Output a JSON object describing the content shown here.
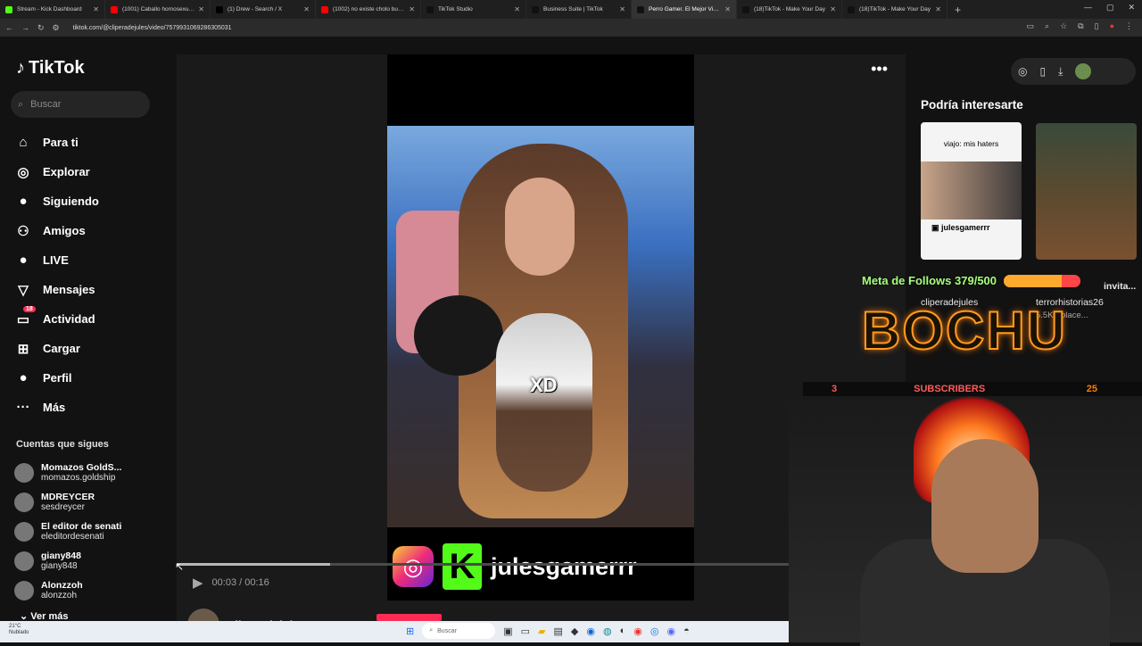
{
  "browser": {
    "tabs": [
      {
        "label": "Stream - Kick Dashboard",
        "color": "#53fc18"
      },
      {
        "label": "(1001) Caballo homosexual de",
        "color": "#ff0000"
      },
      {
        "label": "(1) Drew - Search / X",
        "color": "#000000"
      },
      {
        "label": "(1002) no existe cholo bueno",
        "color": "#ff0000"
      },
      {
        "label": "TikTok Studio",
        "color": "#111111"
      },
      {
        "label": "Business Suite | TikTok",
        "color": "#111111"
      },
      {
        "label": "Perro Gamer. El Mejor Video d",
        "color": "#111111",
        "active": true
      },
      {
        "label": "(18)TikTok - Make Your Day",
        "color": "#111111"
      },
      {
        "label": "(18)TikTok - Make Your Day",
        "color": "#111111"
      }
    ],
    "url": "tiktok.com/@cliperadejules/video/7579931069286305031"
  },
  "sidebar": {
    "logo": "TikTok",
    "search_placeholder": "Buscar",
    "nav": [
      {
        "label": "Para ti",
        "icon": "home-icon",
        "glyph": "⌂"
      },
      {
        "label": "Explorar",
        "icon": "compass-icon",
        "glyph": "◎"
      },
      {
        "label": "Siguiendo",
        "icon": "following-avatar-icon",
        "glyph": "●"
      },
      {
        "label": "Amigos",
        "icon": "friends-icon",
        "glyph": "⚇"
      },
      {
        "label": "LIVE",
        "icon": "live-icon",
        "glyph": "●"
      },
      {
        "label": "Mensajes",
        "icon": "messages-icon",
        "glyph": "▽"
      },
      {
        "label": "Actividad",
        "icon": "activity-icon",
        "glyph": "▭",
        "badge": "18"
      },
      {
        "label": "Cargar",
        "icon": "upload-icon",
        "glyph": "⊞"
      },
      {
        "label": "Perfil",
        "icon": "profile-icon",
        "glyph": "●"
      },
      {
        "label": "Más",
        "icon": "more-icon",
        "glyph": "···"
      }
    ],
    "following_title": "Cuentas que sigues",
    "following": [
      {
        "name": "Momazos GoldS...",
        "handle": "momazos.goldship"
      },
      {
        "name": "MDREYCER",
        "handle": "sesdreycer"
      },
      {
        "name": "El editor de senati",
        "handle": "eleditordesenati"
      },
      {
        "name": "giany848",
        "handle": "giany848"
      },
      {
        "name": "Alonzzoh",
        "handle": "alonzzoh"
      }
    ],
    "see_more": "Ver más"
  },
  "video": {
    "caption_overlay": "XD",
    "social_handle": "julesgamerrr",
    "time": "00:03 / 00:16",
    "progress": 0.25,
    "author": "cliperadejules"
  },
  "right": {
    "title": "Podría interesarte",
    "thumb1_caption": "viajo: mis haters",
    "thumb1_handle": "julesgamerrr",
    "card1_name": "cliperadejules",
    "card2_name": "terrorhistorias26",
    "card2_partial": "invita...",
    "card2_meta": "5.5K · place..."
  },
  "stream_overlay": {
    "goal_label": "Meta de Follows 379/500",
    "goal_progress": 0.758,
    "brand": "BOCHU",
    "subs_count_left": "3",
    "subs_label": "SUBSCRIBERS",
    "subs_count_right": "25"
  },
  "taskbar": {
    "weather": "21°C",
    "weather_desc": "Nublado",
    "search": "Buscar"
  }
}
